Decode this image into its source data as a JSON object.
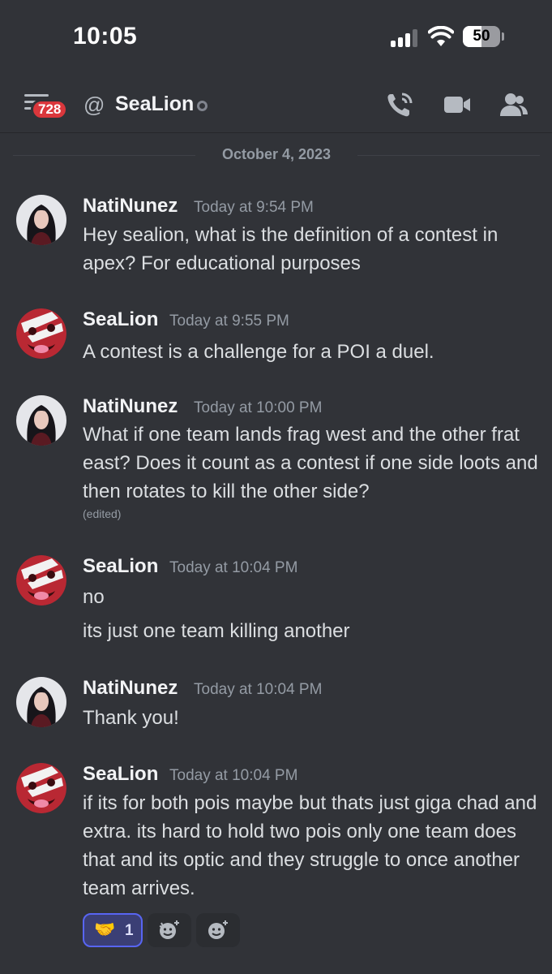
{
  "status_bar": {
    "time": "10:05",
    "battery": "50"
  },
  "header": {
    "unread_badge": "728",
    "at_symbol": "@",
    "channel_name": "SeaLion"
  },
  "date_divider": "October 4, 2023",
  "messages": [
    {
      "author": "NatiNunez",
      "time": "Today at 9:54 PM",
      "lines": [
        "Hey sealion, what is the definition of a contest in apex? For educational purposes"
      ]
    },
    {
      "author": "SeaLion",
      "time": "Today at 9:55 PM",
      "lines": [
        "A contest is a challenge for a POI a duel."
      ]
    },
    {
      "author": "NatiNunez",
      "time": "Today at 10:00 PM",
      "lines": [
        "What if one team lands frag west and the other frat east? Does it count as a contest if one side loots and then rotates to kill the other side?"
      ],
      "edited": "(edited)"
    },
    {
      "author": "SeaLion",
      "time": "Today at 10:04 PM",
      "lines": [
        "no",
        "its just one team killing another"
      ]
    },
    {
      "author": "NatiNunez",
      "time": "Today at 10:04 PM",
      "lines": [
        "Thank you!"
      ]
    },
    {
      "author": "SeaLion",
      "time": "Today at 10:04 PM",
      "lines": [
        "if its for both pois maybe but thats just giga chad and extra. its hard to hold two pois only one team does that and its optic and they struggle to once another team arrives."
      ]
    }
  ],
  "reactions": {
    "handshake_count": "1",
    "handshake_emoji": "🤝"
  },
  "colors": {
    "background": "#313338",
    "accent": "#5865f2",
    "badge": "#da373c"
  }
}
